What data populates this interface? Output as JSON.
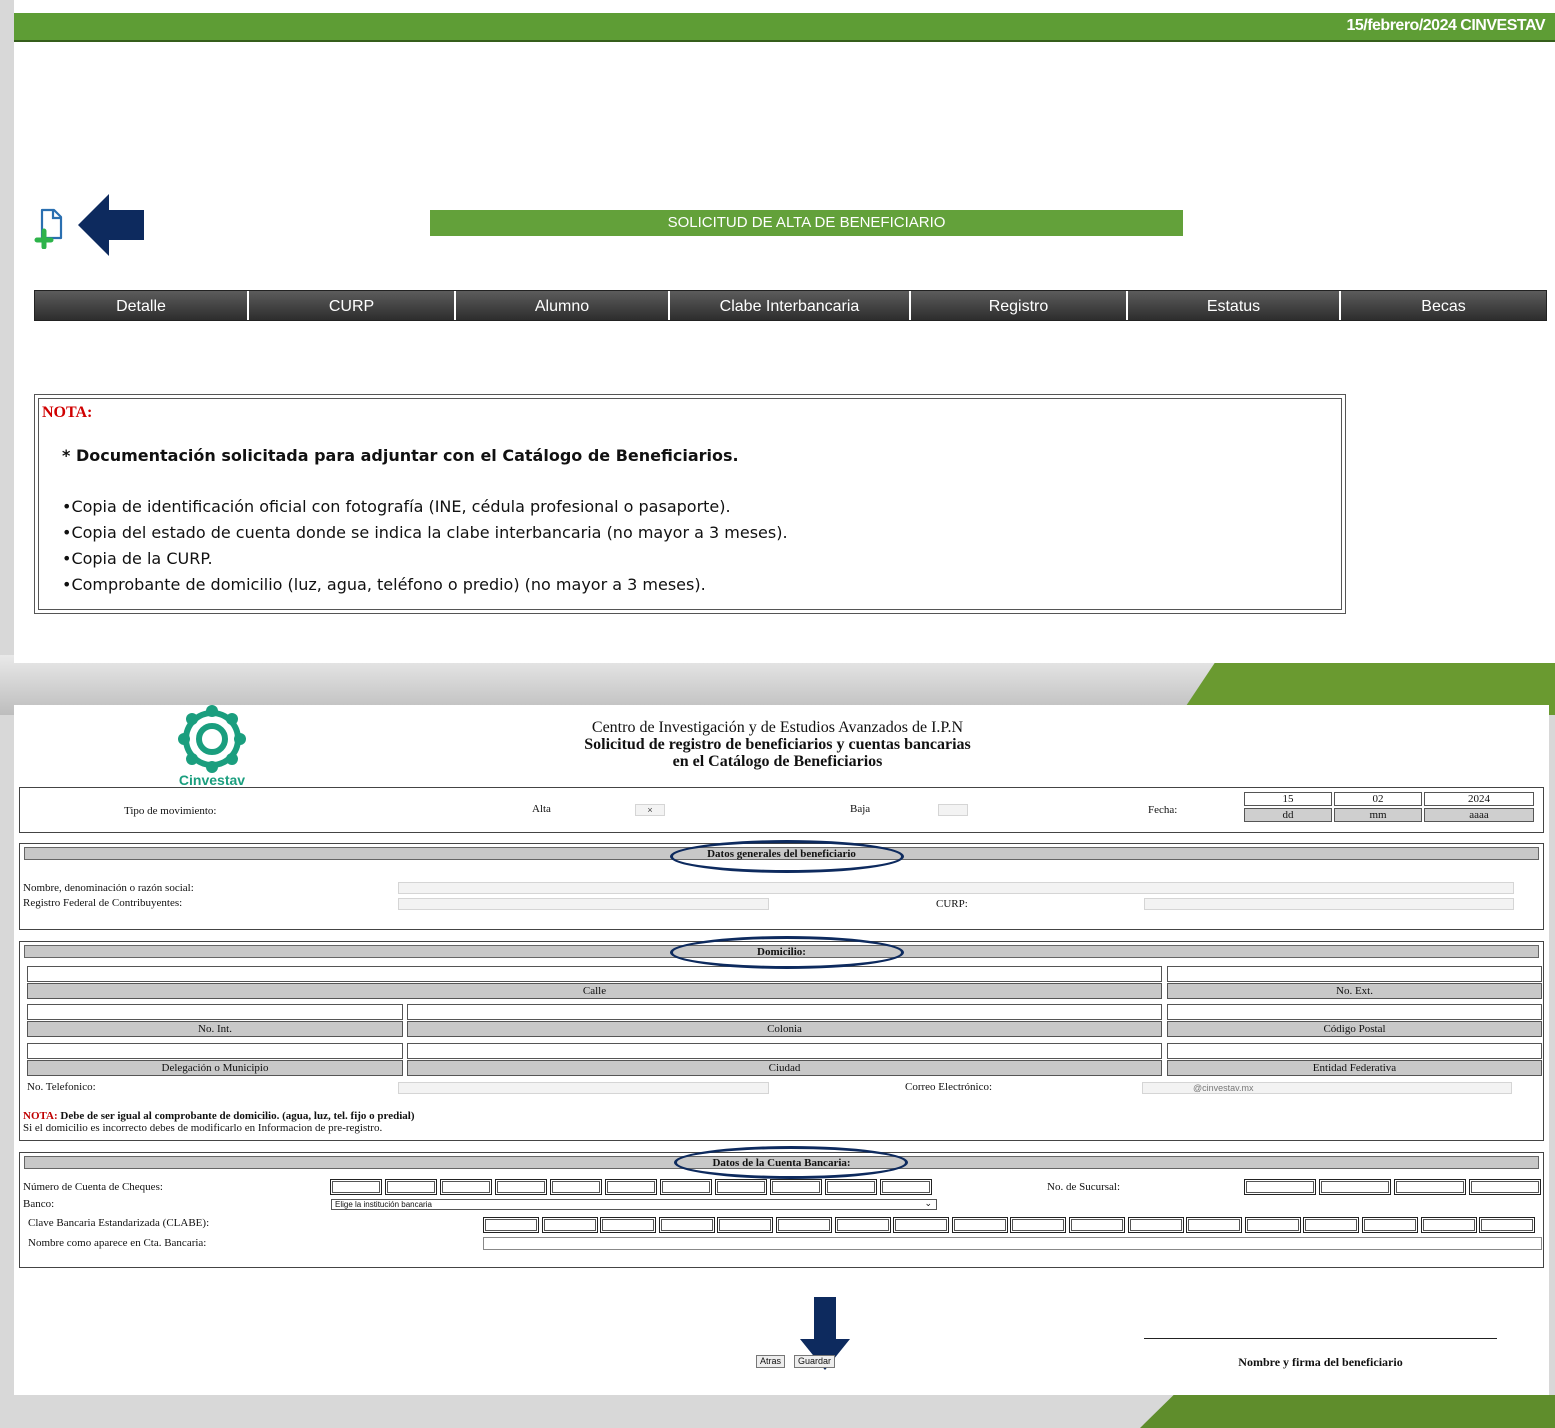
{
  "top": {
    "date_banner": "15/febrero/2024 CINVESTAV",
    "page_title": "SOLICITUD DE ALTA DE BENEFICIARIO",
    "table_headers": [
      "Detalle",
      "CURP",
      "Alumno",
      "Clabe Interbancaria",
      "Registro",
      "Estatus",
      "Becas"
    ]
  },
  "nota": {
    "label": "NOTA:",
    "heading": "* Documentación solicitada para adjuntar con el Catálogo de Beneficiarios.",
    "items": [
      "•Copia de identificación oficial con fotografía (INE, cédula profesional o pasaporte).",
      "•Copia del estado de cuenta donde se indica la clabe interbancaria (no mayor a 3 meses).",
      "•Copia de la CURP.",
      "•Comprobante de domicilio (luz, agua, teléfono o predio) (no mayor a 3 meses)."
    ]
  },
  "form": {
    "logo_text": "Cinvestav",
    "title_line1": "Centro de Investigación y de Estudios Avanzados de I.P.N",
    "title_line2": "Solicitud de registro de beneficiarios y cuentas bancarias",
    "title_line3": "en el Catálogo de Beneficiarios",
    "movimiento": {
      "tipo_label": "Tipo de movimiento:",
      "alta_label": "Alta",
      "alta_value": "×",
      "baja_label": "Baja",
      "baja_value": "",
      "fecha_label": "Fecha:",
      "fecha_values": [
        "15",
        "02",
        "2024"
      ],
      "fecha_labels": [
        "dd",
        "mm",
        "aaaa"
      ]
    },
    "generales": {
      "title": "Datos generales del beneficiario",
      "nombre_label": "Nombre, denominación o razón social:",
      "rfc_label": "Registro Federal de Contribuyentes:",
      "curp_label": "CURP:"
    },
    "domicilio": {
      "title": "Domicilio:",
      "labels": {
        "calle": "Calle",
        "no_ext": "No. Ext.",
        "no_int": "No. Int.",
        "colonia": "Colonia",
        "codigo_postal": "Código Postal",
        "delegacion": "Delegación o Municipio",
        "ciudad": "Ciudad",
        "entidad": "Entidad Federativa"
      },
      "telefono_label": "No. Telefonico:",
      "correo_label": "Correo Electrónico:",
      "correo_value": "@cinvestav.mx",
      "nota_label": "NOTA:",
      "nota_text": " Debe de ser igual al comprobante de domicilio. (agua, luz, tel. fijo o predial)",
      "nota_text2": "Si el domicilio es incorrecto debes de modificarlo en Informacion de pre-registro."
    },
    "cuenta": {
      "title": "Datos de la Cuenta Bancaria:",
      "cheques_label": "Número de Cuenta de Cheques:",
      "sucursal_label": "No. de Sucursal:",
      "banco_label": "Banco:",
      "banco_placeholder": "Elige la institución bancaria",
      "clabe_label": "Clave Bancaria Estandarizada (CLABE):",
      "nombre_label": "Nombre como aparece en Cta. Bancaria:"
    },
    "signature_label": "Nombre y firma del beneficiario",
    "buttons": {
      "back": "Atras",
      "save": "Guardar"
    }
  }
}
